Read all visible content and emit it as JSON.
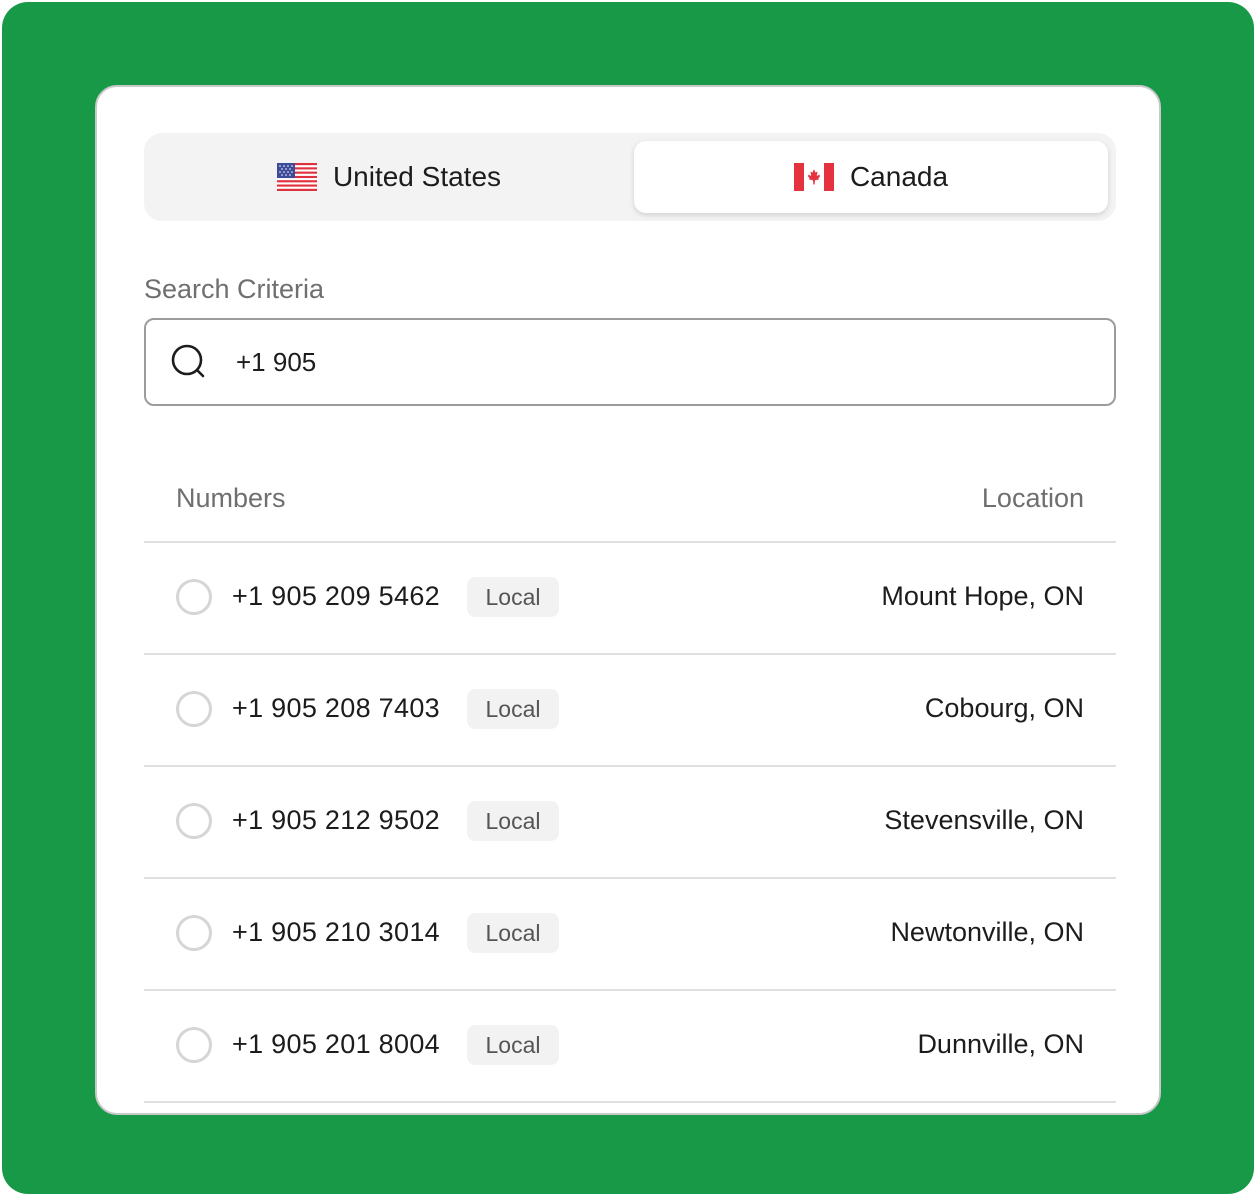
{
  "tabs": [
    {
      "label": "United States",
      "flag": "us-flag-icon",
      "selected": false
    },
    {
      "label": "Canada",
      "flag": "canada-flag-icon",
      "selected": true
    }
  ],
  "search": {
    "label": "Search Criteria",
    "value": "+1 905",
    "icon": "search-icon"
  },
  "table": {
    "headers": {
      "numbers": "Numbers",
      "location": "Location"
    },
    "rows": [
      {
        "number": "+1 905 209 5462",
        "badge": "Local",
        "location": "Mount Hope, ON"
      },
      {
        "number": "+1 905 208 7403",
        "badge": "Local",
        "location": "Cobourg, ON"
      },
      {
        "number": "+1 905 212 9502",
        "badge": "Local",
        "location": "Stevensville, ON"
      },
      {
        "number": "+1 905 210 3014",
        "badge": "Local",
        "location": "Newtonville, ON"
      },
      {
        "number": "+1 905 201 8004",
        "badge": "Local",
        "location": "Dunnville, ON"
      }
    ]
  },
  "colors": {
    "background": "#189947",
    "card": "#ffffff",
    "segment": "#f3f3f3",
    "text": "#1c1c1c",
    "muted": "#6f6f6f"
  }
}
